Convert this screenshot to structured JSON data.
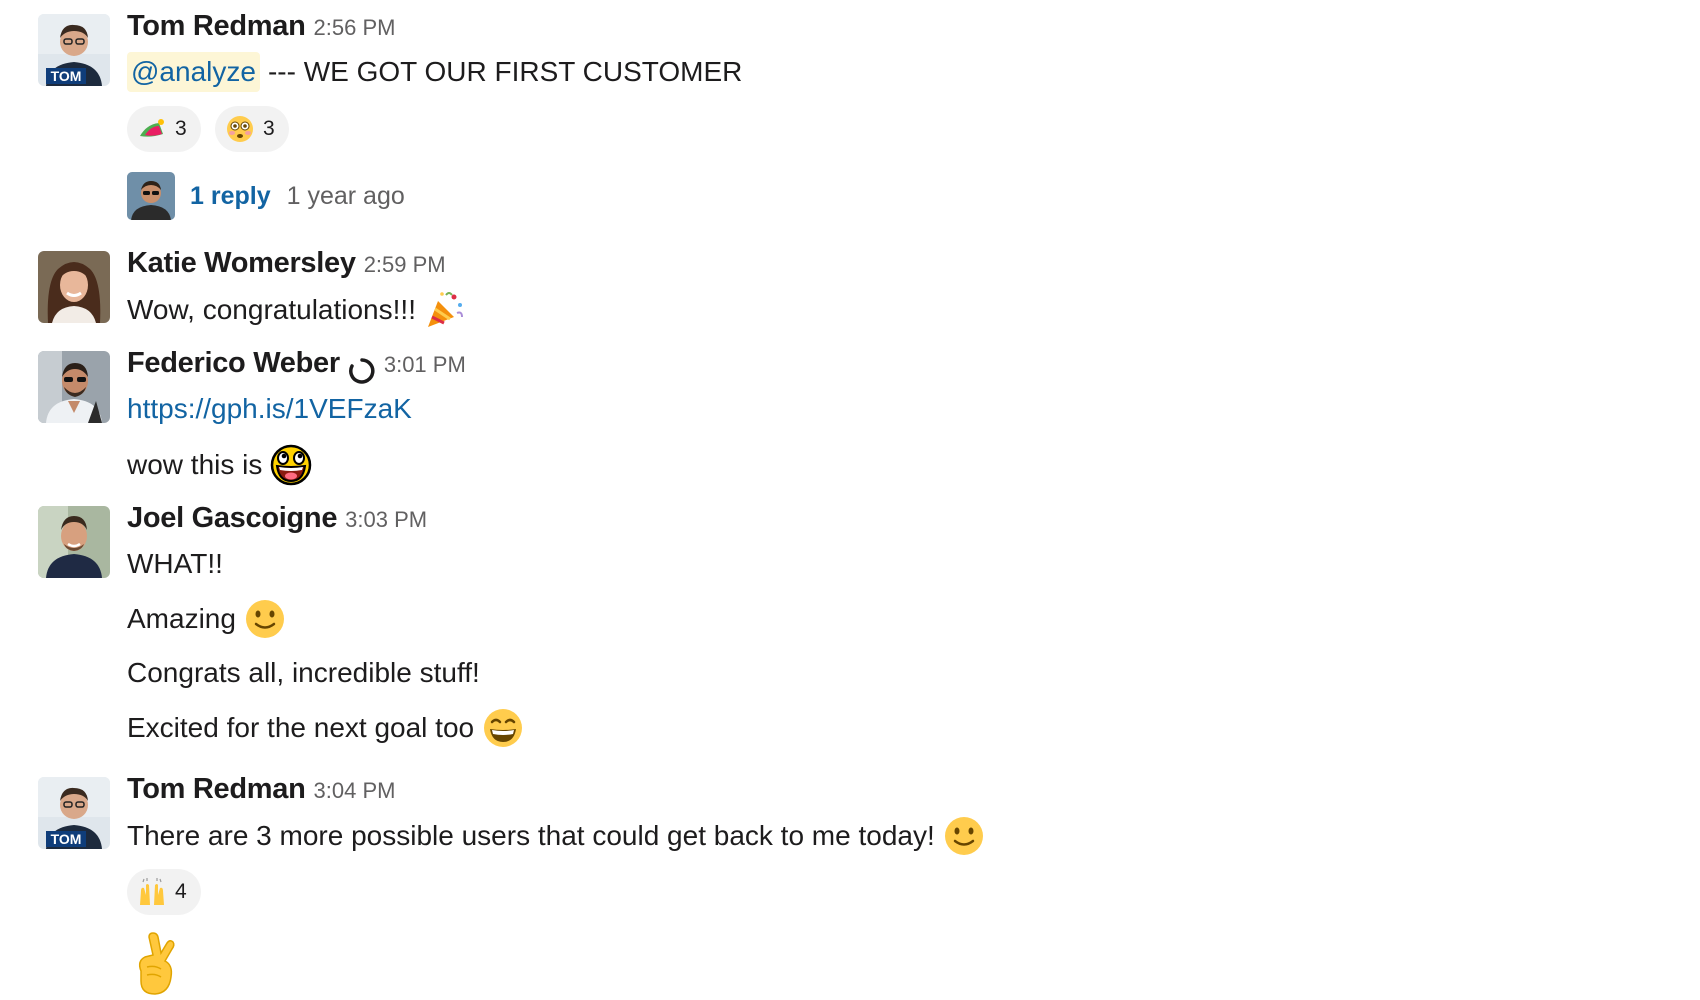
{
  "messages": [
    {
      "author": "Tom Redman",
      "time": "2:56 PM",
      "avatar_badge": "TOM",
      "mention": "@analyze",
      "text": "--- WE GOT OUR FIRST CUSTOMER",
      "reactions": [
        {
          "emoji": "party-hat-icon",
          "count": "3"
        },
        {
          "emoji": "flushed-face-icon",
          "count": "3"
        }
      ],
      "thread": {
        "reply_label": "1 reply",
        "last_reply": "1 year ago"
      }
    },
    {
      "author": "Katie Womersley",
      "time": "2:59 PM",
      "text": "Wow, congratulations!!!",
      "emoji": "party-popper-icon"
    },
    {
      "author": "Federico Weber",
      "time": "3:01 PM",
      "status_icon": "status-ring-icon",
      "link": "https://gph.is/1VEFzaK",
      "text": "wow this is",
      "emoji": "awesome-face-icon"
    },
    {
      "author": "Joel Gascoigne",
      "time": "3:03 PM",
      "lines": [
        {
          "text": "WHAT!!"
        },
        {
          "text": "Amazing",
          "emoji": "slightly-smiling-face-icon"
        },
        {
          "text": "Congrats all, incredible stuff!"
        },
        {
          "text": "Excited for the next goal too",
          "emoji": "grinning-face-icon"
        }
      ]
    },
    {
      "author": "Tom Redman",
      "time": "3:04 PM",
      "avatar_badge": "TOM",
      "text": "There are 3 more possible users that could get back to me today!",
      "emoji": "slightly-smiling-face-icon",
      "reactions": [
        {
          "emoji": "raised-hands-icon",
          "count": "4"
        }
      ],
      "big_emoji": "crossed-fingers-icon"
    }
  ],
  "colors": {
    "link": "#1264a3",
    "mention_bg": "#fdf6d6",
    "reaction_bg": "#f2f2f2",
    "muted_text": "#616061"
  }
}
